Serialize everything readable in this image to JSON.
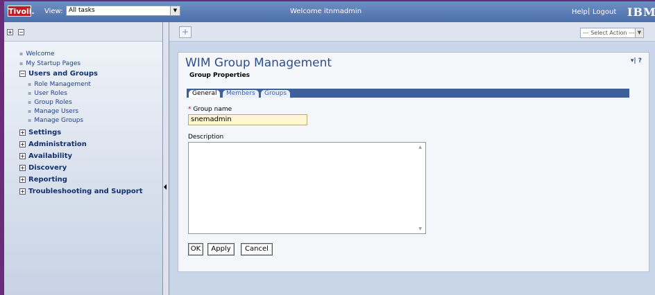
{
  "header": {
    "logo": "Tivoli.",
    "view_label": "View:",
    "view_value": "All tasks",
    "welcome": "Welcome  itnmadmin",
    "help": "Help",
    "separator": "|",
    "logout": "Logout",
    "ibm": "IBM."
  },
  "toolbar": {
    "expand_glyph": "+",
    "collapse_glyph": "−",
    "new_tab_glyph": "+",
    "select_action": "--- Select Action ---"
  },
  "nav": {
    "top_items": [
      "Welcome",
      "My Startup Pages"
    ],
    "users_groups": {
      "label": "Users and Groups",
      "children": [
        "Role Management",
        "User Roles",
        "Group Roles",
        "Manage Users",
        "Manage Groups"
      ]
    },
    "categories": [
      "Settings",
      "Administration",
      "Availability",
      "Discovery",
      "Reporting",
      "Troubleshooting and Support"
    ]
  },
  "portlet": {
    "title": "WIM Group Management",
    "menu": "▾| ?",
    "section": "Group Properties",
    "tabs": [
      "General",
      "Members",
      "Groups"
    ],
    "required_marker": "*",
    "group_name_label": "Group name",
    "group_name_value": "snemadmin",
    "description_label": "Description",
    "description_value": "",
    "buttons": {
      "ok": "OK",
      "apply": "Apply",
      "cancel": "Cancel"
    }
  },
  "colors": {
    "header": "#5a7cb6",
    "tivoli_red": "#c11d21",
    "tab_bar": "#3f5f99",
    "input_highlight": "#fff6d4"
  }
}
